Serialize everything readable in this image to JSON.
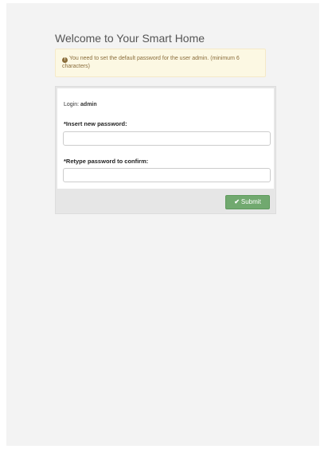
{
  "page": {
    "title": "Welcome to Your Smart Home"
  },
  "alert": {
    "icon": "info-icon",
    "message": "You need to set the default password for the user admin. (minimum 6 characters)"
  },
  "form": {
    "login_label": "Login:",
    "login_value": "admin",
    "new_password_label": "*Insert new password:",
    "new_password_value": "",
    "confirm_password_label": "*Retype password to confirm:",
    "confirm_password_value": "",
    "submit_label": "Submit",
    "submit_icon": "check-icon"
  },
  "colors": {
    "alert_background": "#fcf8e3",
    "alert_text": "#8a6d3b",
    "submit_background": "#71a96f",
    "panel_footer": "#e6e6e6"
  }
}
